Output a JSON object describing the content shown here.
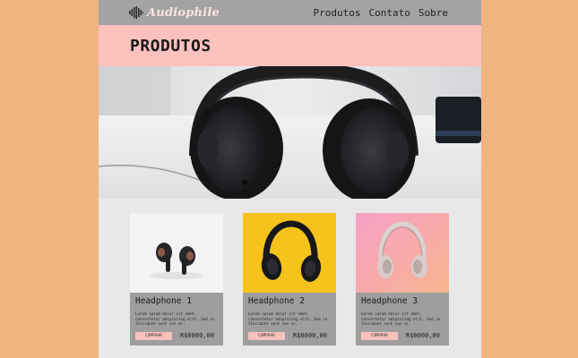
{
  "header": {
    "logo_text": "Audiophile",
    "nav": [
      "Produtos",
      "Contato",
      "Sobre"
    ]
  },
  "page_title": "PRODUTOS",
  "products": [
    {
      "name": "Headphone 1",
      "description": "Lorem ipsum dolor sit amet, consectetur adipiscing elit. Sed in tincidunt sunt sus ei.",
      "button": "COMPRAR",
      "price": "R$0000,00",
      "image_background": "#f3f3f3"
    },
    {
      "name": "Headphone 2",
      "description": "Lorem ipsum dolor sit amet, consectetur adipiscing elit. Sed in tincidunt sunt sus ei.",
      "button": "COMPRAR",
      "price": "R$0000,00",
      "image_background": "#f5c31c"
    },
    {
      "name": "Headphone 3",
      "description": "Lorem ipsum dolor sit amet, consectetur adipiscing elit. Sed in tincidunt sunt sus ei.",
      "button": "COMPRAR",
      "price": "R$0000,00",
      "image_background": "#f7a5c4"
    }
  ],
  "colors": {
    "outer_background": "#efb580",
    "header_background": "#a3a3a3",
    "title_band": "#fbc1bd",
    "card_background": "#9e9e9e",
    "button_background": "#fbc1bd"
  }
}
